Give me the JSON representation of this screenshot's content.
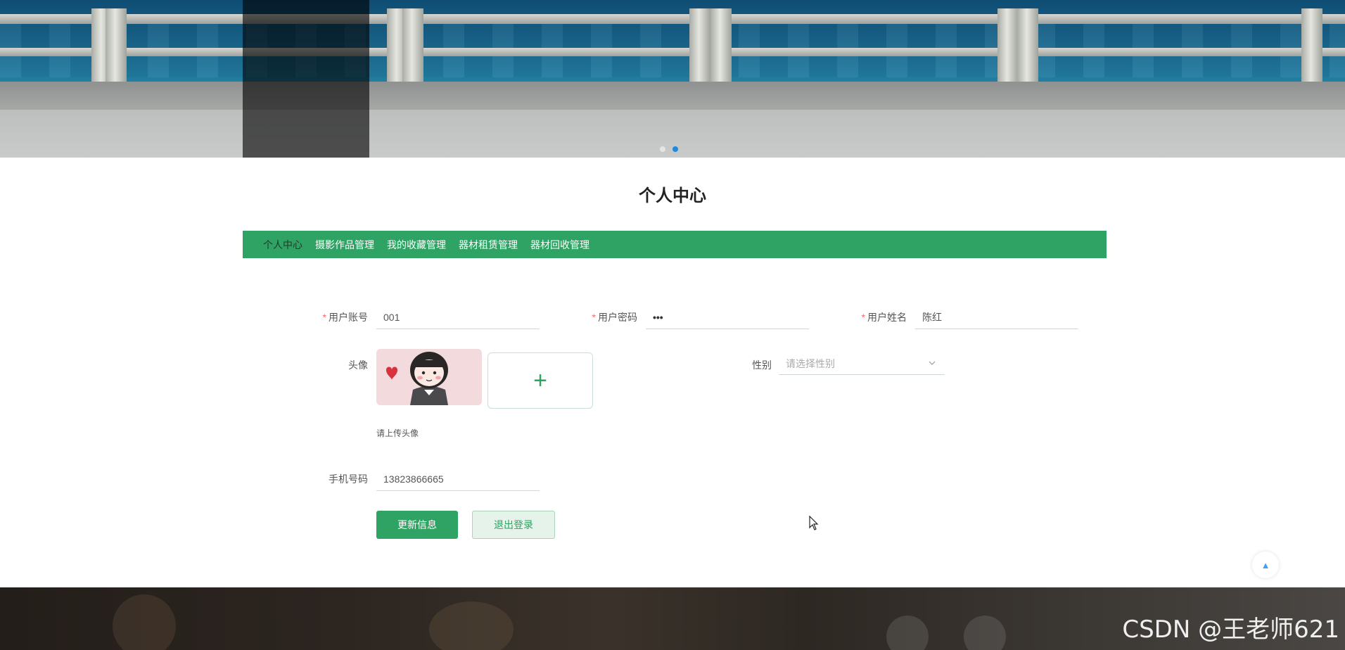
{
  "banner": {
    "active_slide": 2,
    "slide_count": 2
  },
  "page": {
    "title": "个人中心"
  },
  "tabs": [
    {
      "label": "个人中心",
      "active": true
    },
    {
      "label": "摄影作品管理",
      "active": false
    },
    {
      "label": "我的收藏管理",
      "active": false
    },
    {
      "label": "器材租赁管理",
      "active": false
    },
    {
      "label": "器材回收管理",
      "active": false
    }
  ],
  "form": {
    "account": {
      "label": "用户账号",
      "required": "*",
      "value": "001"
    },
    "password": {
      "label": "用户密码",
      "required": "*",
      "value": "•••"
    },
    "name": {
      "label": "用户姓名",
      "required": "*",
      "value": "陈红"
    },
    "avatar": {
      "label": "头像",
      "upload_icon": "+",
      "hint": "请上传头像"
    },
    "gender": {
      "label": "性别",
      "placeholder": "请选择性别",
      "icon": "chevron-down-icon"
    },
    "phone": {
      "label": "手机号码",
      "value": "13823866665"
    }
  },
  "buttons": {
    "update": "更新信息",
    "logout": "退出登录"
  },
  "back_to_top": {
    "icon": "caret-up-icon",
    "glyph": "▲"
  },
  "watermark": "CSDN @王老师621",
  "colors": {
    "accent": "#2fa363",
    "required": "#f56c6c",
    "active_dot": "#1e88e5"
  }
}
